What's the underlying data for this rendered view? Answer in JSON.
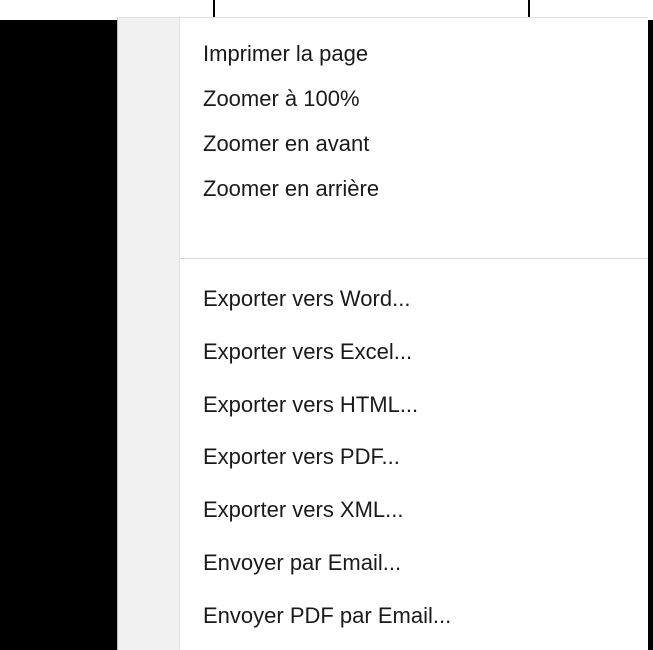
{
  "menu": {
    "group_view": [
      "Imprimer la page",
      "Zoomer à 100%",
      "Zoomer en avant",
      "Zoomer en arrière"
    ],
    "group_export": [
      "Exporter vers Word...",
      "Exporter vers Excel...",
      "Exporter vers HTML...",
      "Exporter vers PDF...",
      "Exporter vers XML...",
      "Envoyer par Email...",
      "Envoyer PDF par Email..."
    ]
  },
  "colors": {
    "background": "#000000",
    "menu_background": "#ffffff",
    "gutter": "#f1f1f1",
    "separator": "#d7d7d7",
    "text": "#1a1a1a"
  }
}
